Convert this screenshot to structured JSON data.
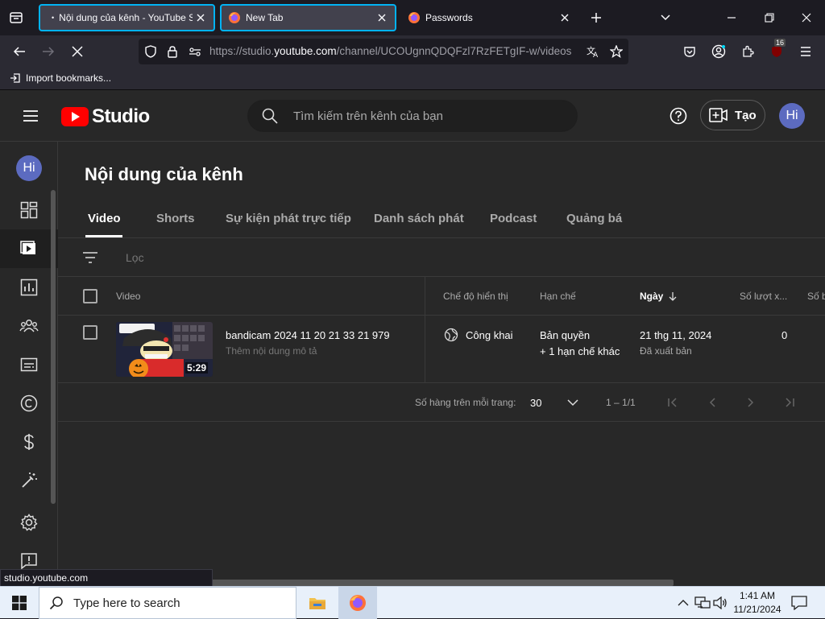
{
  "browser": {
    "tabs": [
      {
        "title": "Nội dung của kênh - YouTube Studio"
      },
      {
        "title": "New Tab"
      },
      {
        "title": "Passwords"
      }
    ],
    "url": {
      "prefix": "https://studio.",
      "host": "youtube.com",
      "path": "/channel/UCOUgnnQDQFzl7RzFETgIF-w/videos"
    },
    "extension_badge": "16",
    "bookmarks": {
      "import_label": "Import bookmarks..."
    },
    "status_tip": "studio.youtube.com"
  },
  "studio": {
    "logo_text": "Studio",
    "search_placeholder": "Tìm kiếm trên kênh của bạn",
    "create_label": "Tạo",
    "avatar_initials": "Hi",
    "page_title": "Nội dung của kênh",
    "tabs": [
      "Video",
      "Shorts",
      "Sự kiện phát trực tiếp",
      "Danh sách phát",
      "Podcast",
      "Quảng bá"
    ],
    "filter_placeholder": "Lọc",
    "columns": {
      "video": "Video",
      "visibility": "Chế độ hiển thị",
      "restrictions": "Hạn chế",
      "date": "Ngày",
      "views": "Số lượt x...",
      "comments": "Số b"
    },
    "videos": [
      {
        "title": "bandicam 2024 11 20 21 33 21 979",
        "description": "Thêm nội dung mô tả",
        "duration": "5:29",
        "visibility": "Công khai",
        "restriction": "Bản quyền",
        "restriction_more": "+ 1 hạn chế khác",
        "date": "21 thg 11, 2024",
        "date_status": "Đã xuất bản",
        "views": "0"
      }
    ],
    "pager": {
      "rows_label": "Số hàng trên mỗi trang:",
      "rows_value": "30",
      "range": "1 – 1/1"
    }
  },
  "taskbar": {
    "search_placeholder": "Type here to search",
    "time": "1:41 AM",
    "date": "11/21/2024"
  }
}
